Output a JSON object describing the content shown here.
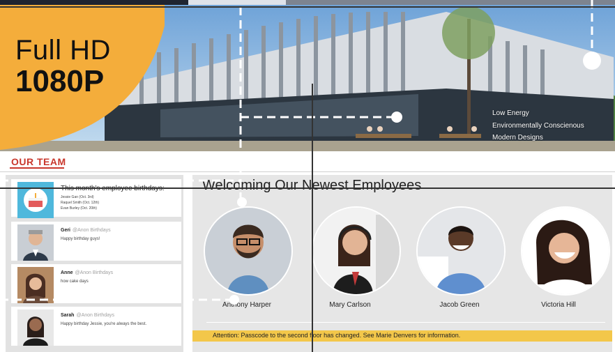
{
  "badge": {
    "line1": "Full HD",
    "line2": "1080P",
    "color": "#f4ad3b"
  },
  "hero": {
    "taglines": [
      "Low Energy",
      "Environmentally Conscienous",
      "Modern Designs"
    ]
  },
  "team": {
    "title": "OUR TEAM",
    "birthday_card": {
      "title": "This month's employee birthdays:",
      "lines": [
        "Jessie Gan (Oct. 3rd)",
        "Raquel Smith (Oct. 12th)",
        "Evan Burley (Oct. 20th)"
      ]
    },
    "posts": [
      {
        "name": "Geri",
        "handle": "@Anon Birthdays",
        "message": "Happy birthday guys!"
      },
      {
        "name": "Anne",
        "handle": "@Anon Birthdays",
        "message": "how cake days"
      },
      {
        "name": "Sarah",
        "handle": "@Anon Birthdays",
        "message": "Happy birthday Jessie, you're always the best."
      }
    ]
  },
  "welcome": {
    "title": "Welcoming Our Newest Employees",
    "employees": [
      {
        "name": "Anthony Harper"
      },
      {
        "name": "Mary Carlson"
      },
      {
        "name": "Jacob Green"
      },
      {
        "name": "Victoria Hill"
      }
    ]
  },
  "alert": {
    "text": "Attention: Passcode to the second floor has changed. See Marie Denvers for information.",
    "color": "#f3c74a"
  },
  "accent": "#c9372c"
}
